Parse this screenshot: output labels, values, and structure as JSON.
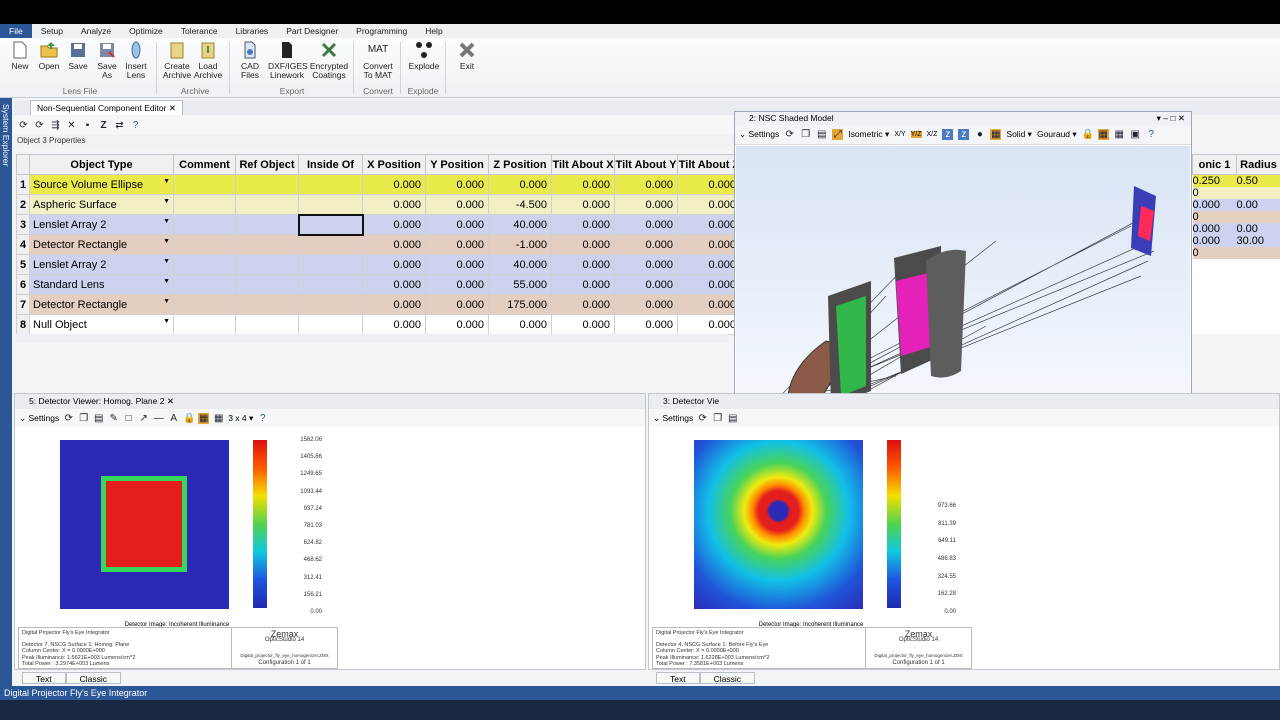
{
  "menu": [
    "File",
    "Setup",
    "Analyze",
    "Optimize",
    "Tolerance",
    "Libraries",
    "Part Designer",
    "Programming",
    "Help"
  ],
  "ribbon": {
    "buttons": [
      {
        "label": "New",
        "icon": "new-file-icon"
      },
      {
        "label": "Open",
        "icon": "folder-open-icon"
      },
      {
        "label": "Save",
        "icon": "save-icon"
      },
      {
        "label": "Save As",
        "icon": "save-as-icon"
      },
      {
        "label": "Insert Lens",
        "icon": "insert-lens-icon"
      },
      {
        "label": "Create Archive",
        "icon": "create-archive-icon"
      },
      {
        "label": "Load Archive",
        "icon": "load-archive-icon"
      },
      {
        "label": "CAD Files",
        "icon": "cad-files-icon"
      },
      {
        "label": "DXF/IGES Linework",
        "icon": "dxf-iges-icon"
      },
      {
        "label": "Encrypted Coatings",
        "icon": "encrypted-coatings-icon"
      },
      {
        "label": "Convert To MAT",
        "icon": "mat-icon",
        "glyph": "MAT"
      },
      {
        "label": "Explode",
        "icon": "explode-icon"
      },
      {
        "label": "Exit",
        "icon": "exit-icon"
      }
    ],
    "groups": [
      "Lens File",
      "Archive",
      "Export",
      "Convert",
      "Explode"
    ]
  },
  "left_strip": "System Explorer",
  "editor": {
    "tab_title": "Non-Sequential Component Editor",
    "properties_label": "Object 3 Properties",
    "columns": [
      "",
      "Object Type",
      "Comment",
      "Ref Object",
      "Inside Of",
      "X Position",
      "Y Position",
      "Z Position",
      "Tilt About X",
      "Tilt About Y",
      "Tilt About Z"
    ],
    "rows": [
      {
        "n": "1",
        "type": "Source Volume Ellipse",
        "x": "0.000",
        "y": "0.000",
        "z": "0.000",
        "tx": "0.000",
        "ty": "0.000",
        "tz": "0.000",
        "style": "r-yellow"
      },
      {
        "n": "2",
        "type": "Aspheric Surface",
        "x": "0.000",
        "y": "0.000",
        "z": "-4.500",
        "tx": "0.000",
        "ty": "0.000",
        "tz": "0.000",
        "style": "r-ylight"
      },
      {
        "n": "3",
        "type": "Lenslet Array 2",
        "x": "0.000",
        "y": "0.000",
        "z": "40.000",
        "tx": "0.000",
        "ty": "0.000",
        "tz": "0.000",
        "style": "r-blue"
      },
      {
        "n": "4",
        "type": "Detector Rectangle",
        "x": "0.000",
        "y": "0.000",
        "z": "-1.000",
        "tx": "0.000",
        "ty": "0.000",
        "tz": "0.000",
        "style": "r-brown"
      },
      {
        "n": "5",
        "type": "Lenslet Array 2",
        "x": "0.000",
        "y": "0.000",
        "z": "40.000",
        "tx": "0.000",
        "ty": "0.000",
        "tz": "0.000",
        "style": "r-blue"
      },
      {
        "n": "6",
        "type": "Standard Lens",
        "x": "0.000",
        "y": "0.000",
        "z": "55.000",
        "tx": "0.000",
        "ty": "0.000",
        "tz": "0.000",
        "style": "r-blue"
      },
      {
        "n": "7",
        "type": "Detector Rectangle",
        "x": "0.000",
        "y": "0.000",
        "z": "175.000",
        "tx": "0.000",
        "ty": "0.000",
        "tz": "0.000",
        "style": "r-brown"
      },
      {
        "n": "8",
        "type": "Null Object",
        "x": "0.000",
        "y": "0.000",
        "z": "0.000",
        "tx": "0.000",
        "ty": "0.000",
        "tz": "0.000",
        "style": "r-white"
      }
    ],
    "right_headers": [
      "onic 1",
      "Radius"
    ],
    "right_values": [
      [
        "0.250",
        "0.50"
      ],
      [
        "0",
        ""
      ],
      [
        "0.000",
        "0.00"
      ],
      [
        "0",
        ""
      ],
      [
        "0.000",
        "0.00"
      ],
      [
        "0.000",
        "30.00"
      ],
      [
        "0",
        ""
      ],
      [
        "",
        ""
      ]
    ]
  },
  "nsc": {
    "title": "2: NSC Shaded Model",
    "settings": "Settings",
    "view": "Isometric",
    "axes_buttons": [
      "X/Y",
      "Y/Z",
      "X/Z"
    ],
    "render": "Solid",
    "shading": "Gouraud"
  },
  "detector1": {
    "title": "5: Detector Viewer: Homog. Plane 2",
    "settings": "Settings",
    "layout": "3 x 4",
    "scale": [
      "1562.06",
      "1405.86",
      "1249.65",
      "1093.44",
      "937.24",
      "781.03",
      "624.82",
      "468.62",
      "312.41",
      "156.21",
      "0.00"
    ],
    "caption": "Detector Image: Incoherent Illuminance",
    "info": [
      "Digital Projector Fly's Eye Integrator",
      "",
      "Detector 7, NSCG Surface 1: Homog. Plane",
      "Column Center: X = 0.0000E+000",
      "Peak Illuminance: 1.5621E+003 Lumens/cm^2",
      "Total Power    : 3.2974E+003 Lumens"
    ],
    "brand": "Zemax",
    "product": "OpticStudio 14",
    "file": "Digital_projector_fly_eye_homogenizer.ZMX",
    "config": "Configuration 1 of 1"
  },
  "detector2": {
    "title": "3: Detector Vie",
    "settings": "Settings",
    "scale": [
      "973.66",
      "811.39",
      "649.11",
      "486.83",
      "324.55",
      "162.28",
      "0.00"
    ],
    "caption": "Detector Image: Incoherent Illuminance",
    "info": [
      "Digital Projector Fly's Eye Integrator",
      "",
      "Detector 4, NSCG Surface 1: Before Fly's Eye",
      "Column Center: X = 0.0000E+000",
      "Peak Illuminance: 1.6228E+003 Lumens/cm^2",
      "Total Power    : 7.3581E+003 Lumens"
    ],
    "brand": "Zemax",
    "product": "OpticStudio 14",
    "file": "Digital_projector_fly_eye_homogenizer.ZMX",
    "config": "Configuration 1 of 1"
  },
  "bottom_tabs": [
    "Text",
    "Classic"
  ],
  "status": "Digital Projector Fly's Eye Integrator"
}
